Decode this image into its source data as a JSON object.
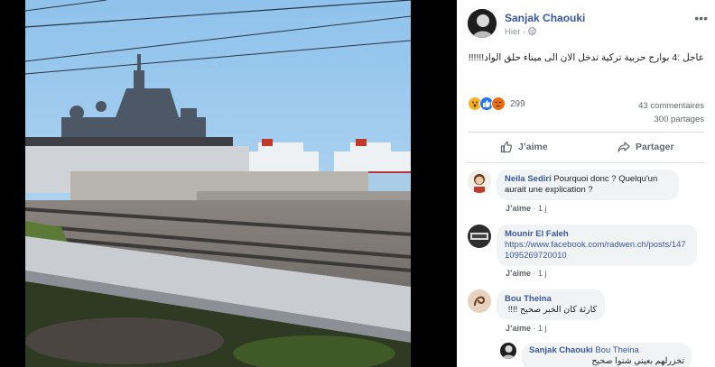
{
  "post": {
    "author": "Sanjak Chaouki",
    "time": "Hier",
    "menu": "•••",
    "text": "عاجل :4 بوارج حربية تركية تدخل الان الى ميناء حلق الواد!!!!!!",
    "reaction_count": "299",
    "comments_count": "43 commentaires",
    "shares_count": "300 partages",
    "like_label": "J’aime",
    "share_label": "Partager"
  },
  "comments": [
    {
      "name": "Neila Sediri",
      "text": "Pourquoi donc ? Quelqu'un aurait une explication ?",
      "like": "J’aime",
      "time": "1 j"
    },
    {
      "name": "Mounir El Faleh",
      "link": "https://www.facebook.com/radwen.ch/posts/1471095269720010",
      "like": "J’aime",
      "time": "1 j"
    },
    {
      "name": "Bou Theina",
      "text": "كارثة كان الخبر صحيح !!!!",
      "like": "J’aime",
      "time": "1 j"
    },
    {
      "name": "Sanjak Chaouki",
      "tag": "Bou Theina",
      "text": "تخزرلهم بعيني شنوا صحيح"
    }
  ],
  "colors": {
    "link": "#385898",
    "meta": "#90949c",
    "bubble": "#f2f3f5"
  }
}
